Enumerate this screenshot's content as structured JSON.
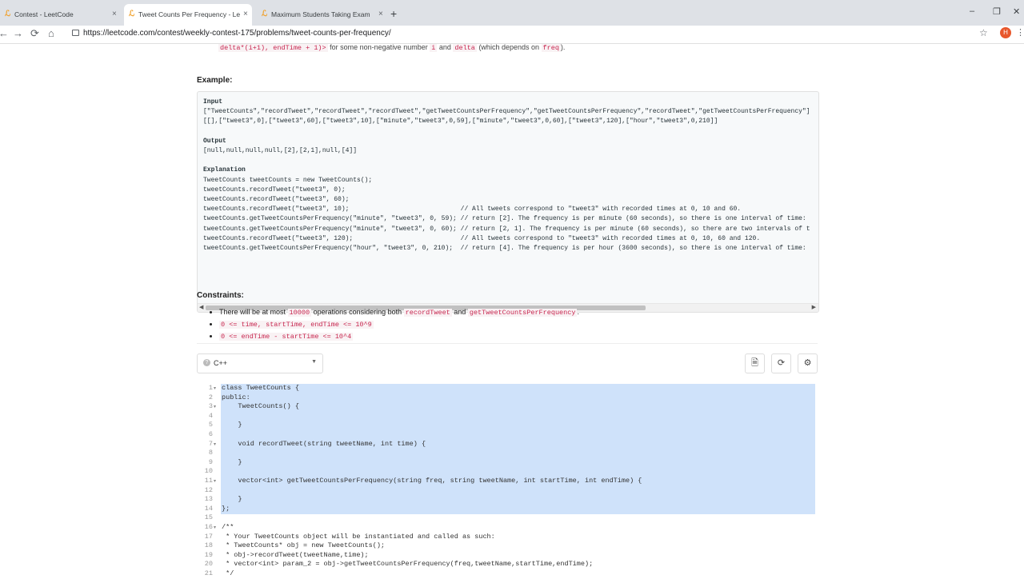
{
  "browser": {
    "tabs": [
      {
        "title": "Contest - LeetCode",
        "close": "×"
      },
      {
        "title": "Tweet Counts Per Frequency - Le",
        "close": "×"
      },
      {
        "title": "Maximum Students Taking Exam",
        "close": "×"
      }
    ],
    "new_tab": "+",
    "window_controls": {
      "minimize": "–",
      "maximize": "❐",
      "close": "✕"
    },
    "nav": {
      "back": "←",
      "forward": "→",
      "reload": "⟳",
      "home": "⌂"
    },
    "url": "https://leetcode.com/contest/weekly-contest-175/problems/tweet-counts-per-frequency/",
    "profile_initial": "H",
    "star": "☆",
    "menu": "⋮"
  },
  "problem": {
    "intro_code1": "delta*(i+1), endTime + 1)>",
    "intro_text1": "for some non-negative number",
    "intro_code2": "i",
    "intro_text2": "and",
    "intro_code3": "delta",
    "intro_text3": "(which depends on",
    "intro_code4": "freq",
    "intro_text4": ").",
    "example_heading": "Example:",
    "example_lines": [
      {
        "text": "Input",
        "bold": true
      },
      {
        "text": "[\"TweetCounts\",\"recordTweet\",\"recordTweet\",\"recordTweet\",\"getTweetCountsPerFrequency\",\"getTweetCountsPerFrequency\",\"recordTweet\",\"getTweetCountsPerFrequency\"]",
        "bold": false
      },
      {
        "text": "[[],[\"tweet3\",0],[\"tweet3\",60],[\"tweet3\",10],[\"minute\",\"tweet3\",0,59],[\"minute\",\"tweet3\",0,60],[\"tweet3\",120],[\"hour\",\"tweet3\",0,210]]",
        "bold": false
      },
      {
        "text": "",
        "bold": false
      },
      {
        "text": "Output",
        "bold": true
      },
      {
        "text": "[null,null,null,null,[2],[2,1],null,[4]]",
        "bold": false
      },
      {
        "text": "",
        "bold": false
      },
      {
        "text": "Explanation",
        "bold": true
      },
      {
        "text": "TweetCounts tweetCounts = new TweetCounts();",
        "bold": false
      },
      {
        "text": "tweetCounts.recordTweet(\"tweet3\", 0);",
        "bold": false
      },
      {
        "text": "tweetCounts.recordTweet(\"tweet3\", 60);",
        "bold": false
      },
      {
        "text": "tweetCounts.recordTweet(\"tweet3\", 10);                             // All tweets correspond to \"tweet3\" with recorded times at 0, 10 and 60.",
        "bold": false
      },
      {
        "text": "tweetCounts.getTweetCountsPerFrequency(\"minute\", \"tweet3\", 0, 59); // return [2]. The frequency is per minute (60 seconds), so there is one interval of time:",
        "bold": false
      },
      {
        "text": "tweetCounts.getTweetCountsPerFrequency(\"minute\", \"tweet3\", 0, 60); // return [2, 1]. The frequency is per minute (60 seconds), so there are two intervals of t",
        "bold": false
      },
      {
        "text": "tweetCounts.recordTweet(\"tweet3\", 120);                            // All tweets correspond to \"tweet3\" with recorded times at 0, 10, 60 and 120.",
        "bold": false
      },
      {
        "text": "tweetCounts.getTweetCountsPerFrequency(\"hour\", \"tweet3\", 0, 210);  // return [4]. The frequency is per hour (3600 seconds), so there is one interval of time:",
        "bold": false
      }
    ],
    "constraints_heading": "Constraints:",
    "constraint1_pre": "There will be at most",
    "constraint1_code1": "10000",
    "constraint1_mid": "operations considering both",
    "constraint1_code2": "recordTweet",
    "constraint1_and": "and",
    "constraint1_code3": "getTweetCountsPerFrequency",
    "constraint1_end": ".",
    "constraint2": "0 <= time, startTime, endTime <= 10^9",
    "constraint3": "0 <= endTime - startTime <= 10^4"
  },
  "editor": {
    "language_icon": "?",
    "language": "C++",
    "caret": "▼",
    "buttons": {
      "notes": "🗎",
      "reset": "⟳",
      "settings": "⚙"
    },
    "lines": [
      {
        "n": "1",
        "fold": "▾",
        "text": "class TweetCounts {",
        "cls": "kw"
      },
      {
        "n": "2",
        "fold": "",
        "text": "public:",
        "cls": "kw"
      },
      {
        "n": "3",
        "fold": "▾",
        "text": "    TweetCounts() {",
        "cls": ""
      },
      {
        "n": "4",
        "fold": "",
        "text": "",
        "cls": ""
      },
      {
        "n": "5",
        "fold": "",
        "text": "    }",
        "cls": ""
      },
      {
        "n": "6",
        "fold": "",
        "text": "",
        "cls": ""
      },
      {
        "n": "7",
        "fold": "▾",
        "text": "    void recordTweet(string tweetName, int time) {",
        "cls": ""
      },
      {
        "n": "8",
        "fold": "",
        "text": "",
        "cls": ""
      },
      {
        "n": "9",
        "fold": "",
        "text": "    }",
        "cls": ""
      },
      {
        "n": "10",
        "fold": "",
        "text": "",
        "cls": ""
      },
      {
        "n": "11",
        "fold": "▾",
        "text": "    vector<int> getTweetCountsPerFrequency(string freq, string tweetName, int startTime, int endTime) {",
        "cls": ""
      },
      {
        "n": "12",
        "fold": "",
        "text": "",
        "cls": ""
      },
      {
        "n": "13",
        "fold": "",
        "text": "    }",
        "cls": ""
      },
      {
        "n": "14",
        "fold": "",
        "text": "};",
        "cls": ""
      },
      {
        "n": "15",
        "fold": "",
        "text": "",
        "cls": ""
      },
      {
        "n": "16",
        "fold": "▾",
        "text": "/**",
        "cls": "cm"
      },
      {
        "n": "17",
        "fold": "",
        "text": " * Your TweetCounts object will be instantiated and called as such:",
        "cls": "cm"
      },
      {
        "n": "18",
        "fold": "",
        "text": " * TweetCounts* obj = new TweetCounts();",
        "cls": "cm"
      },
      {
        "n": "19",
        "fold": "",
        "text": " * obj->recordTweet(tweetName,time);",
        "cls": "cm"
      },
      {
        "n": "20",
        "fold": "",
        "text": " * vector<int> param_2 = obj->getTweetCountsPerFrequency(freq,tweetName,startTime,endTime);",
        "cls": "cm"
      },
      {
        "n": "21",
        "fold": "",
        "text": " */",
        "cls": "cm"
      }
    ]
  }
}
